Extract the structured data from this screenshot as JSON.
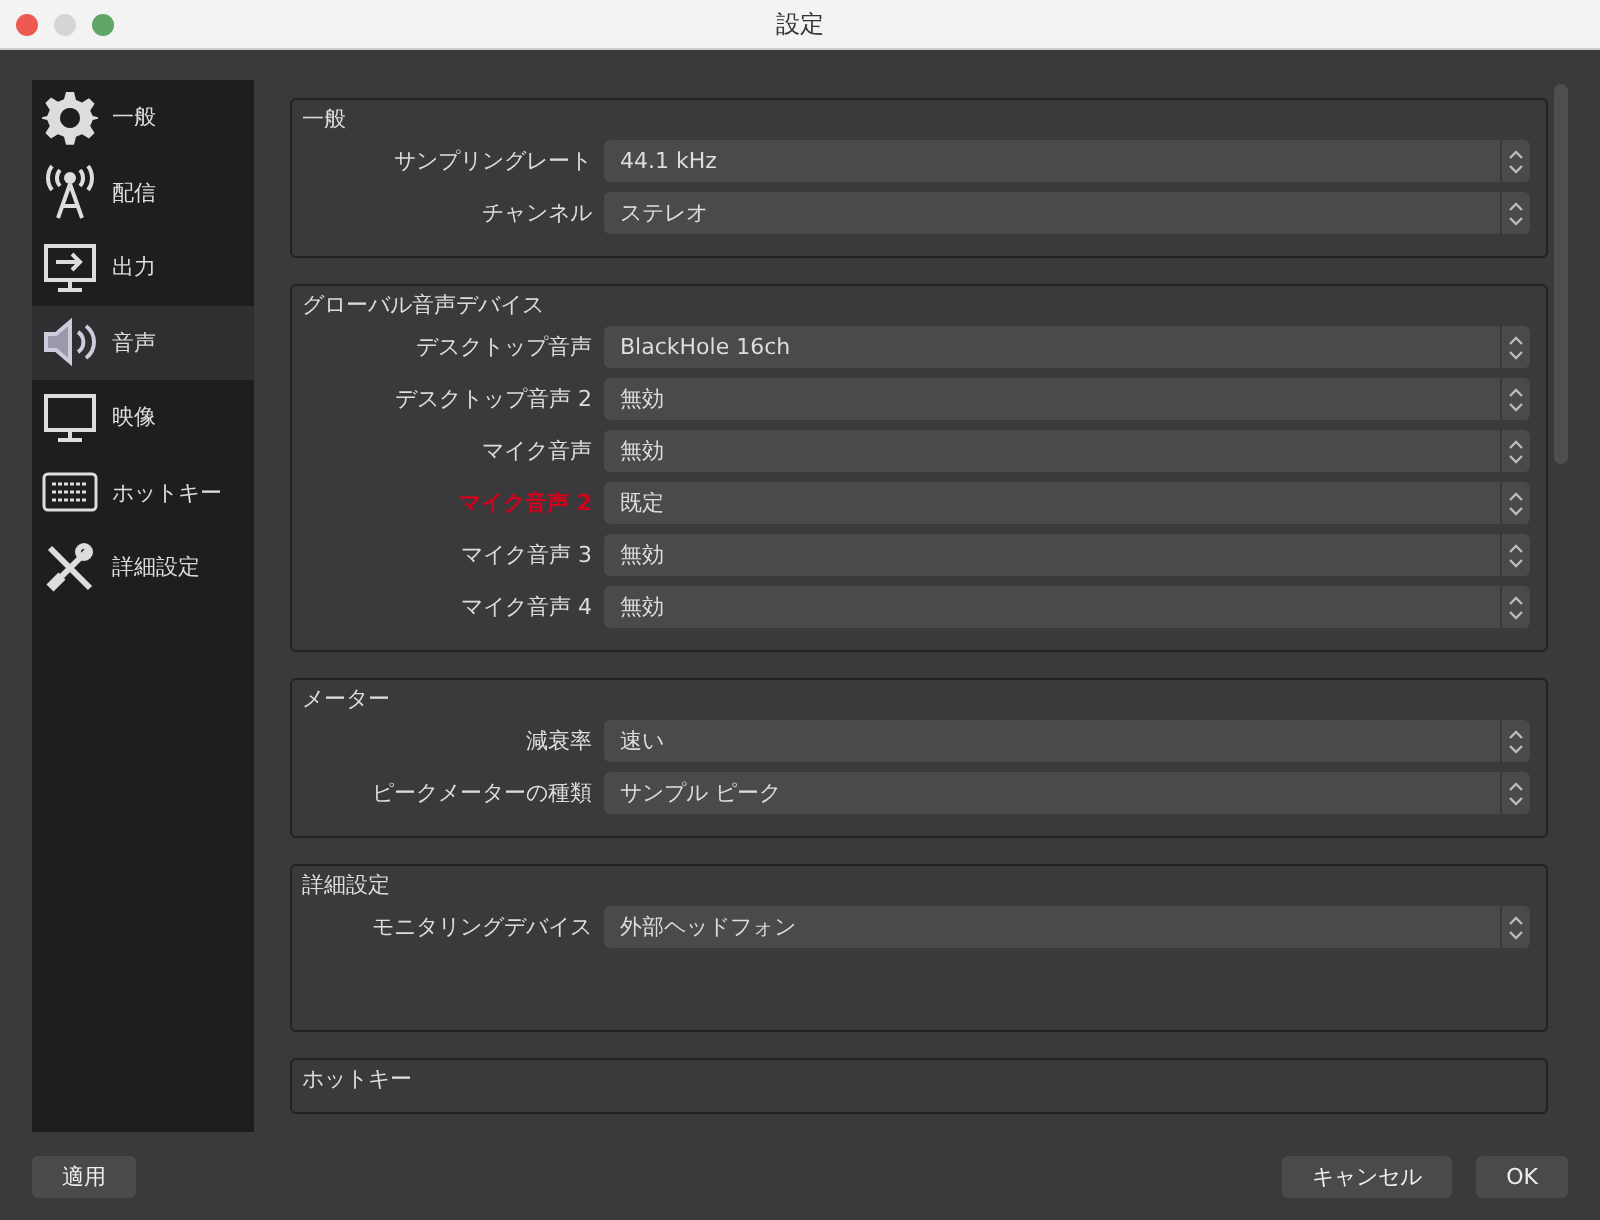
{
  "window": {
    "title": "設定"
  },
  "sidebar": {
    "items": [
      {
        "label": "一般",
        "kind": "gear",
        "selected": false
      },
      {
        "label": "配信",
        "kind": "antenna",
        "selected": false
      },
      {
        "label": "出力",
        "kind": "output",
        "selected": false
      },
      {
        "label": "音声",
        "kind": "speaker",
        "selected": true
      },
      {
        "label": "映像",
        "kind": "monitor",
        "selected": false
      },
      {
        "label": "ホットキー",
        "kind": "keyboard",
        "selected": false
      },
      {
        "label": "詳細設定",
        "kind": "tools",
        "selected": false
      }
    ]
  },
  "sections": [
    {
      "title": "一般",
      "rows": [
        {
          "label": "サンプリングレート",
          "value": "44.1 kHz",
          "highlighted": false
        },
        {
          "label": "チャンネル",
          "value": "ステレオ",
          "highlighted": false
        }
      ]
    },
    {
      "title": "グローバル音声デバイス",
      "rows": [
        {
          "label": "デスクトップ音声",
          "value": "BlackHole 16ch",
          "highlighted": false
        },
        {
          "label": "デスクトップ音声 2",
          "value": "無効",
          "highlighted": false
        },
        {
          "label": "マイク音声",
          "value": "無効",
          "highlighted": false
        },
        {
          "label": "マイク音声 2",
          "value": "既定",
          "highlighted": true
        },
        {
          "label": "マイク音声 3",
          "value": "無効",
          "highlighted": false
        },
        {
          "label": "マイク音声 4",
          "value": "無効",
          "highlighted": false
        }
      ]
    },
    {
      "title": "メーター",
      "rows": [
        {
          "label": "減衰率",
          "value": "速い",
          "highlighted": false
        },
        {
          "label": "ピークメーターの種類",
          "value": "サンプル ピーク",
          "highlighted": false
        }
      ]
    },
    {
      "title": "詳細設定",
      "rows": [
        {
          "label": "モニタリングデバイス",
          "value": "外部ヘッドフォン",
          "highlighted": false
        }
      ],
      "extra_space": true
    },
    {
      "title": "ホットキー"
    }
  ],
  "footer": {
    "apply": "適用",
    "cancel": "キャンセル",
    "ok": "OK"
  }
}
